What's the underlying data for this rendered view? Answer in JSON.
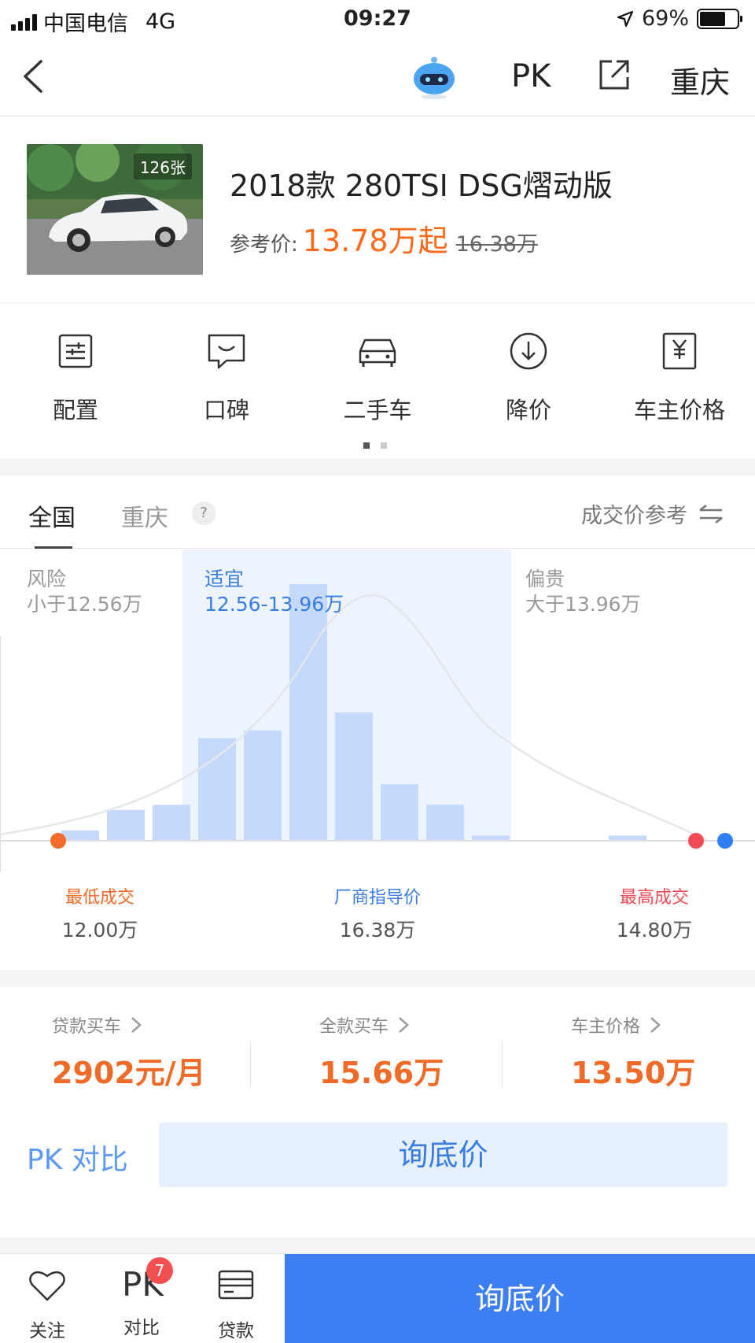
{
  "status_bar": {
    "carrier": "中国电信",
    "network": "4G",
    "time": "09:27",
    "battery": "69%",
    "battery_level": 0.69
  },
  "nav": {
    "pk_label": "PK",
    "city": "重庆",
    "icons": [
      "back-icon",
      "robot-assistant-icon",
      "share-icon"
    ]
  },
  "car": {
    "photo_count": "126张",
    "title": "2018款 280TSI DSG熠动版",
    "price_label": "参考价:",
    "price": "13.78万起",
    "original_price": "16.38万"
  },
  "quick_menu": {
    "items": [
      {
        "label": "配置",
        "icon": "config-sliders-icon"
      },
      {
        "label": "口碑",
        "icon": "comment-bubble-icon"
      },
      {
        "label": "二手车",
        "icon": "car-icon"
      },
      {
        "label": "降价",
        "icon": "price-drop-icon"
      },
      {
        "label": "车主价格",
        "icon": "yen-tag-icon"
      }
    ],
    "page_count": 2,
    "active_page": 1
  },
  "region_tabs": {
    "active": "全国",
    "city": "重庆",
    "help": "?",
    "reference": "成交价参考"
  },
  "price_ranges": {
    "risk": {
      "title": "风险",
      "range": "小于12.56万"
    },
    "fair": {
      "title": "适宜",
      "range": "12.56-13.96万"
    },
    "expensive": {
      "title": "偏贵",
      "range": "大于13.96万"
    }
  },
  "price_stats": {
    "lowest_label": "最低成交",
    "lowest_value": "12.00万",
    "msrp_label": "厂商指导价",
    "msrp_value": "16.38万",
    "highest_label": "最高成交",
    "highest_value": "14.80万"
  },
  "chart_data": {
    "type": "bar",
    "title": "",
    "xlabel": "",
    "ylabel": "",
    "bar_relative_heights": [
      0.04,
      0.12,
      0.14,
      0.4,
      0.43,
      1.0,
      0.5,
      0.22,
      0.14,
      0.02,
      0.0,
      0.0,
      0.02
    ],
    "shaded_range_bars": [
      3,
      8
    ],
    "colors": {
      "bars": "#c4d9fb",
      "fair_zone": "#eef4fd",
      "curve": "#e3e6ea",
      "low_marker": "#f26b2a",
      "high_marker": "#f24a55",
      "msrp_marker": "#2f7ff2"
    }
  },
  "purchase_options": [
    {
      "label": "贷款买车",
      "value": "2902元/月"
    },
    {
      "label": "全款买车",
      "value": "15.66万"
    },
    {
      "label": "车主价格",
      "value": "13.50万"
    }
  ],
  "cta": {
    "pk_compare": "PK 对比",
    "inquiry": "询底价"
  },
  "bottom_bar": {
    "follow": "关注",
    "compare": "对比",
    "compare_badge": "7",
    "loan": "贷款",
    "inquiry": "询底价"
  },
  "colors": {
    "accent_orange": "#ff6a1a",
    "primary_blue": "#3d7ef2",
    "link_blue": "#5d9af5"
  }
}
